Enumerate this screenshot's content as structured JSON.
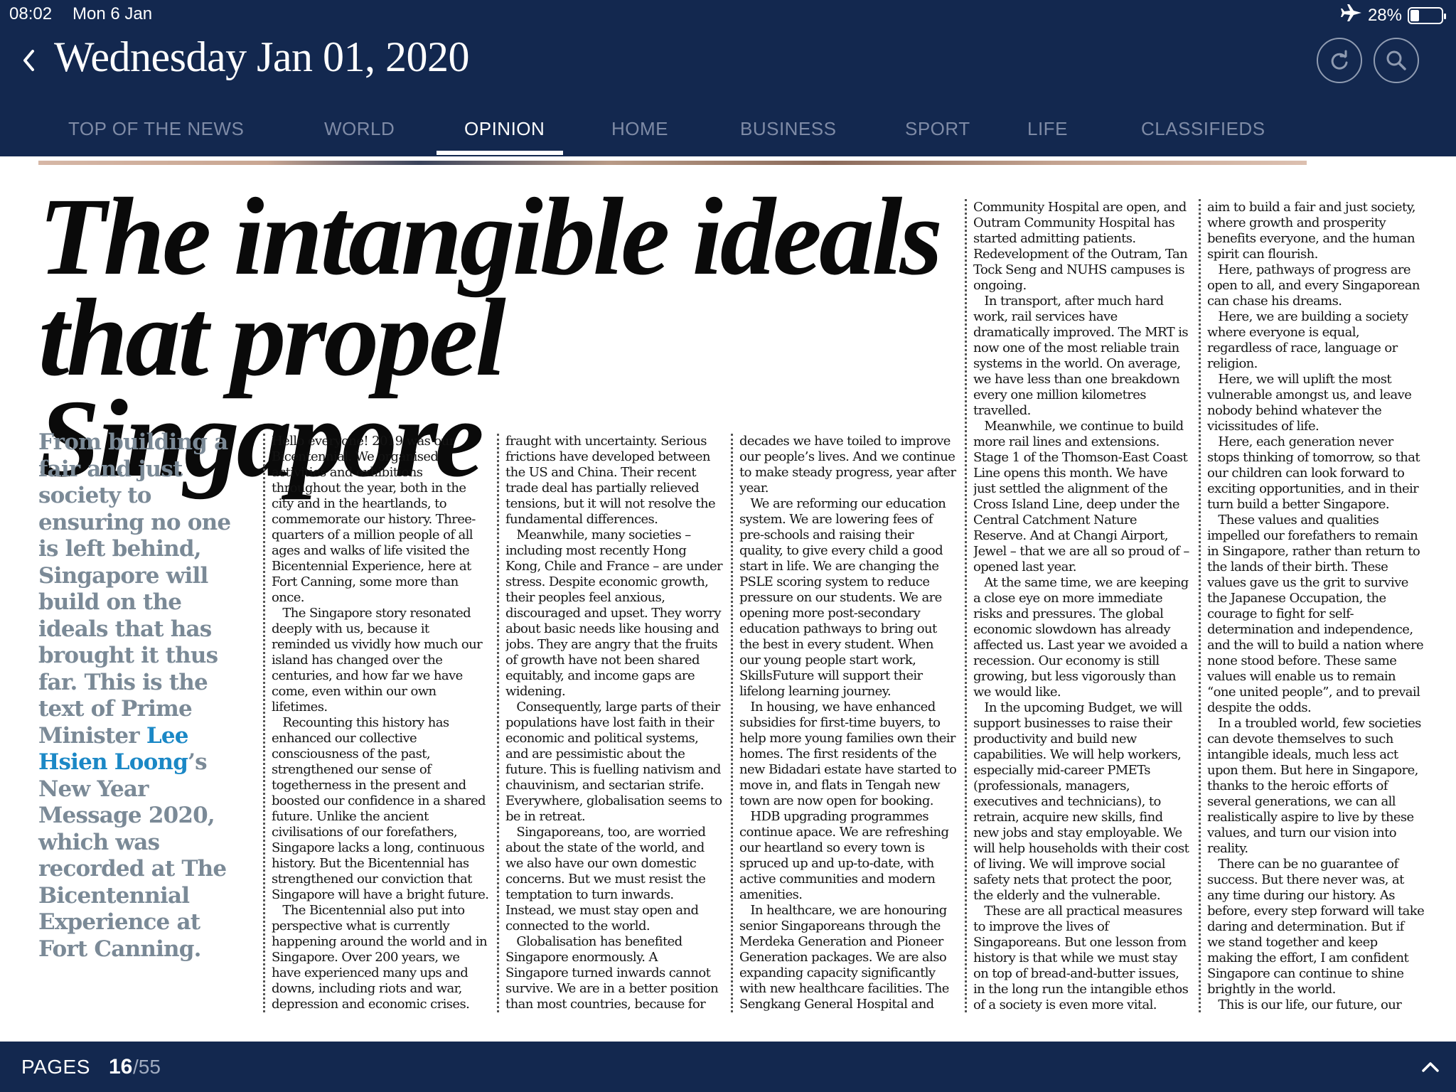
{
  "status_bar": {
    "time": "08:02",
    "date": "Mon 6 Jan",
    "battery_text": "28%",
    "battery_level": 0.28,
    "airplane_icon": "airplane-icon"
  },
  "header": {
    "date_title": "Wednesday Jan 01, 2020",
    "back_icon": "chevron-left-icon",
    "refresh_icon": "refresh-icon",
    "search_icon": "search-icon"
  },
  "nav": {
    "tabs": [
      {
        "label": "TOP OF THE NEWS",
        "active": false
      },
      {
        "label": "WORLD",
        "active": false
      },
      {
        "label": "OPINION",
        "active": true
      },
      {
        "label": "HOME",
        "active": false
      },
      {
        "label": "BUSINESS",
        "active": false
      },
      {
        "label": "SPORT",
        "active": false
      },
      {
        "label": "LIFE",
        "active": false
      },
      {
        "label": "CLASSIFIEDS",
        "active": false
      }
    ]
  },
  "article": {
    "headline_line1": "The intangible ideals",
    "headline_line2": "that propel Singapore",
    "standfirst_before": "From building a fair and just society to ensuring no one is left behind, Singapore will build on the ideals that has brought it thus far. This is the text of Prime Minister ",
    "standfirst_link": "Lee Hsien Loong",
    "standfirst_after": "’s New Year Message 2020, which was recorded at The Bicentennial Experience at Fort Canning.",
    "columns": [
      "Hello everyone! 2019 was our Bicentennial. We organised activities and exhibitions throughout the year, both in the city and in the heartlands, to commemorate our history. Three-quarters of a million people of all ages and walks of life visited the Bicentennial Experience, here at Fort Canning, some more than once.\n   The Singapore story resonated deeply with us, because it reminded us vividly how much our island has changed over the centuries, and how far we have come, even within our own lifetimes.\n   Recounting this history has enhanced our collective consciousness of the past, strengthened our sense of togetherness in the present and boosted our confidence in a shared future. Unlike the ancient civilisations of our forefathers, Singapore lacks a long, continuous history. But the Bicentennial has strengthened our conviction that Singapore will have a bright future.\n   The Bicentennial also put into perspective what is currently happening around the world and in Singapore. Over 200 years, we have experienced many ups and downs, including riots and war, depression and economic crises.\n   Today, the outlook is again",
      "fraught with uncertainty. Serious frictions have developed between the US and China. Their recent trade deal has partially relieved tensions, but it will not resolve the fundamental differences.\n   Meanwhile, many societies – including most recently Hong Kong, Chile and France – are under stress. Despite economic growth, their peoples feel anxious, discouraged and upset. They worry about basic needs like housing and jobs. They are angry that the fruits of growth have not been shared equitably, and income gaps are widening.\n   Consequently, large parts of their populations have lost faith in their economic and political systems, and are pessimistic about the future. This is fuelling nativism and chauvinism, and sectarian strife. Everywhere, globalisation seems to be in retreat.\n   Singaporeans, too, are worried about the state of the world, and we also have our own domestic concerns. But we must resist the temptation to turn inwards. Instead, we must stay open and connected to the world.\n   Globalisation has benefited Singapore enormously. A Singapore turned inwards cannot survive. We are in a better position than most countries, because for",
      "decades we have toiled to improve our people’s lives. And we continue to make steady progress, year after year.\n   We are reforming our education system. We are lowering fees of pre-schools and raising their quality, to give every child a good start in life. We are changing the PSLE scoring system to reduce pressure on our students. We are opening more post-secondary education pathways to bring out the best in every student. When our young people start work, SkillsFuture will support their lifelong learning journey.\n   In housing, we have enhanced subsidies for first-time buyers, to help more young families own their homes. The first residents of the new Bidadari estate have started to move in, and flats in Tengah new town are now open for booking.\n   HDB upgrading programmes continue apace. We are refreshing our heartland so every town is spruced up and up-to-date, with active communities and modern amenities.\n   In healthcare, we are honouring senior Singaporeans through the Merdeka Generation and Pioneer Generation packages. We are also expanding capacity significantly with new healthcare facilities. The Sengkang General Hospital and",
      "Community Hospital are open, and Outram Community Hospital has started admitting patients. Redevelopment of the Outram, Tan Tock Seng and NUHS campuses is ongoing.\n   In transport, after much hard work, rail services have dramatically improved. The MRT is now one of the most reliable train systems in the world. On average, we have less than one breakdown every one million kilometres travelled.\n   Meanwhile, we continue to build more rail lines and extensions. Stage 1 of the Thomson-East Coast Line opens this month. We have just settled the alignment of the Cross Island Line, deep under the Central Catchment Nature Reserve. And at Changi Airport, Jewel – that we are all so proud of – opened last year.\n   At the same time, we are keeping a close eye on more immediate risks and pressures. The global economic slowdown has already affected us. Last year we avoided a recession. Our economy is still growing, but less vigorously than we would like.\n   In the upcoming Budget, we will support businesses to raise their productivity and build new capabilities. We will help workers, especially mid-career PMETs (professionals, managers, executives and technicians), to retrain, acquire new skills, find new jobs and stay employable. We will help households with their cost of living. We will improve social safety nets that protect the poor, the elderly and the vulnerable.\n   These are all practical measures to improve the lives of Singaporeans. But one lesson from history is that while we must stay on top of bread-and-butter issues, in the long run the intangible ethos of a society is even more vital.\n   Here, in this island-nation, we",
      "aim to build a fair and just society, where growth and prosperity benefits everyone, and the human spirit can flourish.\n   Here, pathways of progress are open to all, and every Singaporean can chase his dreams.\n   Here, we are building a society where everyone is equal, regardless of race, language or religion.\n   Here, we will uplift the most vulnerable amongst us, and leave nobody behind whatever the vicissitudes of life.\n   Here, each generation never stops thinking of tomorrow, so that our children can look forward to exciting opportunities, and in their turn build a better Singapore.\n   These values and qualities impelled our forefathers to remain in Singapore, rather than return to the lands of their birth. These values gave us the grit to survive the Japanese Occupation, the courage to fight for self-determination and independence, and the will to build a nation where none stood before. These same values will enable us to remain “one united people”, and to prevail despite the odds.\n   In a troubled world, few societies can devote themselves to such intangible ideals, much less act upon them. But here in Singapore, thanks to the heroic efforts of several generations, we can all realistically aspire to live by these values, and turn our vision into reality.\n   There can be no guarantee of success. But there never was, at any time during our history. As before, every step forward will take daring and determination. But if we stand together and keep making the effort, I am confident Singapore can continue to shine brightly in the world.\n   This is our life, our future, our Singapore.\n   I wish all Singaporeans a Happy New Year!"
    ]
  },
  "footer": {
    "pages_label": "PAGES",
    "current_page": "16",
    "total_pages": "/55",
    "expand_icon": "chevron-up-icon"
  },
  "colors": {
    "header_bg": "#13284f",
    "tab_inactive": "#7f8ba6",
    "standfirst": "#7b8a97",
    "link": "#1b88c6"
  }
}
